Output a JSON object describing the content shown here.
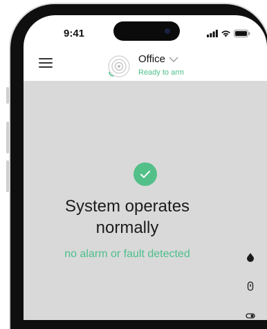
{
  "status_bar": {
    "time": "9:41"
  },
  "header": {
    "hub_name": "Office",
    "hub_status": "Ready to arm"
  },
  "main": {
    "title_line1": "System operates",
    "title_line2": "normally",
    "subtitle": "no alarm or fault detected"
  },
  "icons": {
    "menu": "hamburger-menu-icon",
    "hub": "hub-spiral-icon",
    "chevron": "chevron-down-icon",
    "status_ok": "checkmark-icon",
    "signal": "cellular-signal-icon",
    "wifi": "wifi-icon",
    "battery": "battery-icon",
    "side": [
      "drop-icon",
      "device-icon",
      "toggle-icon"
    ]
  },
  "colors": {
    "accent_green": "#4cbf8c",
    "check_green": "#53c08a",
    "panel_gray": "#d9d9d9",
    "phone_frame": "#0f0f10"
  }
}
